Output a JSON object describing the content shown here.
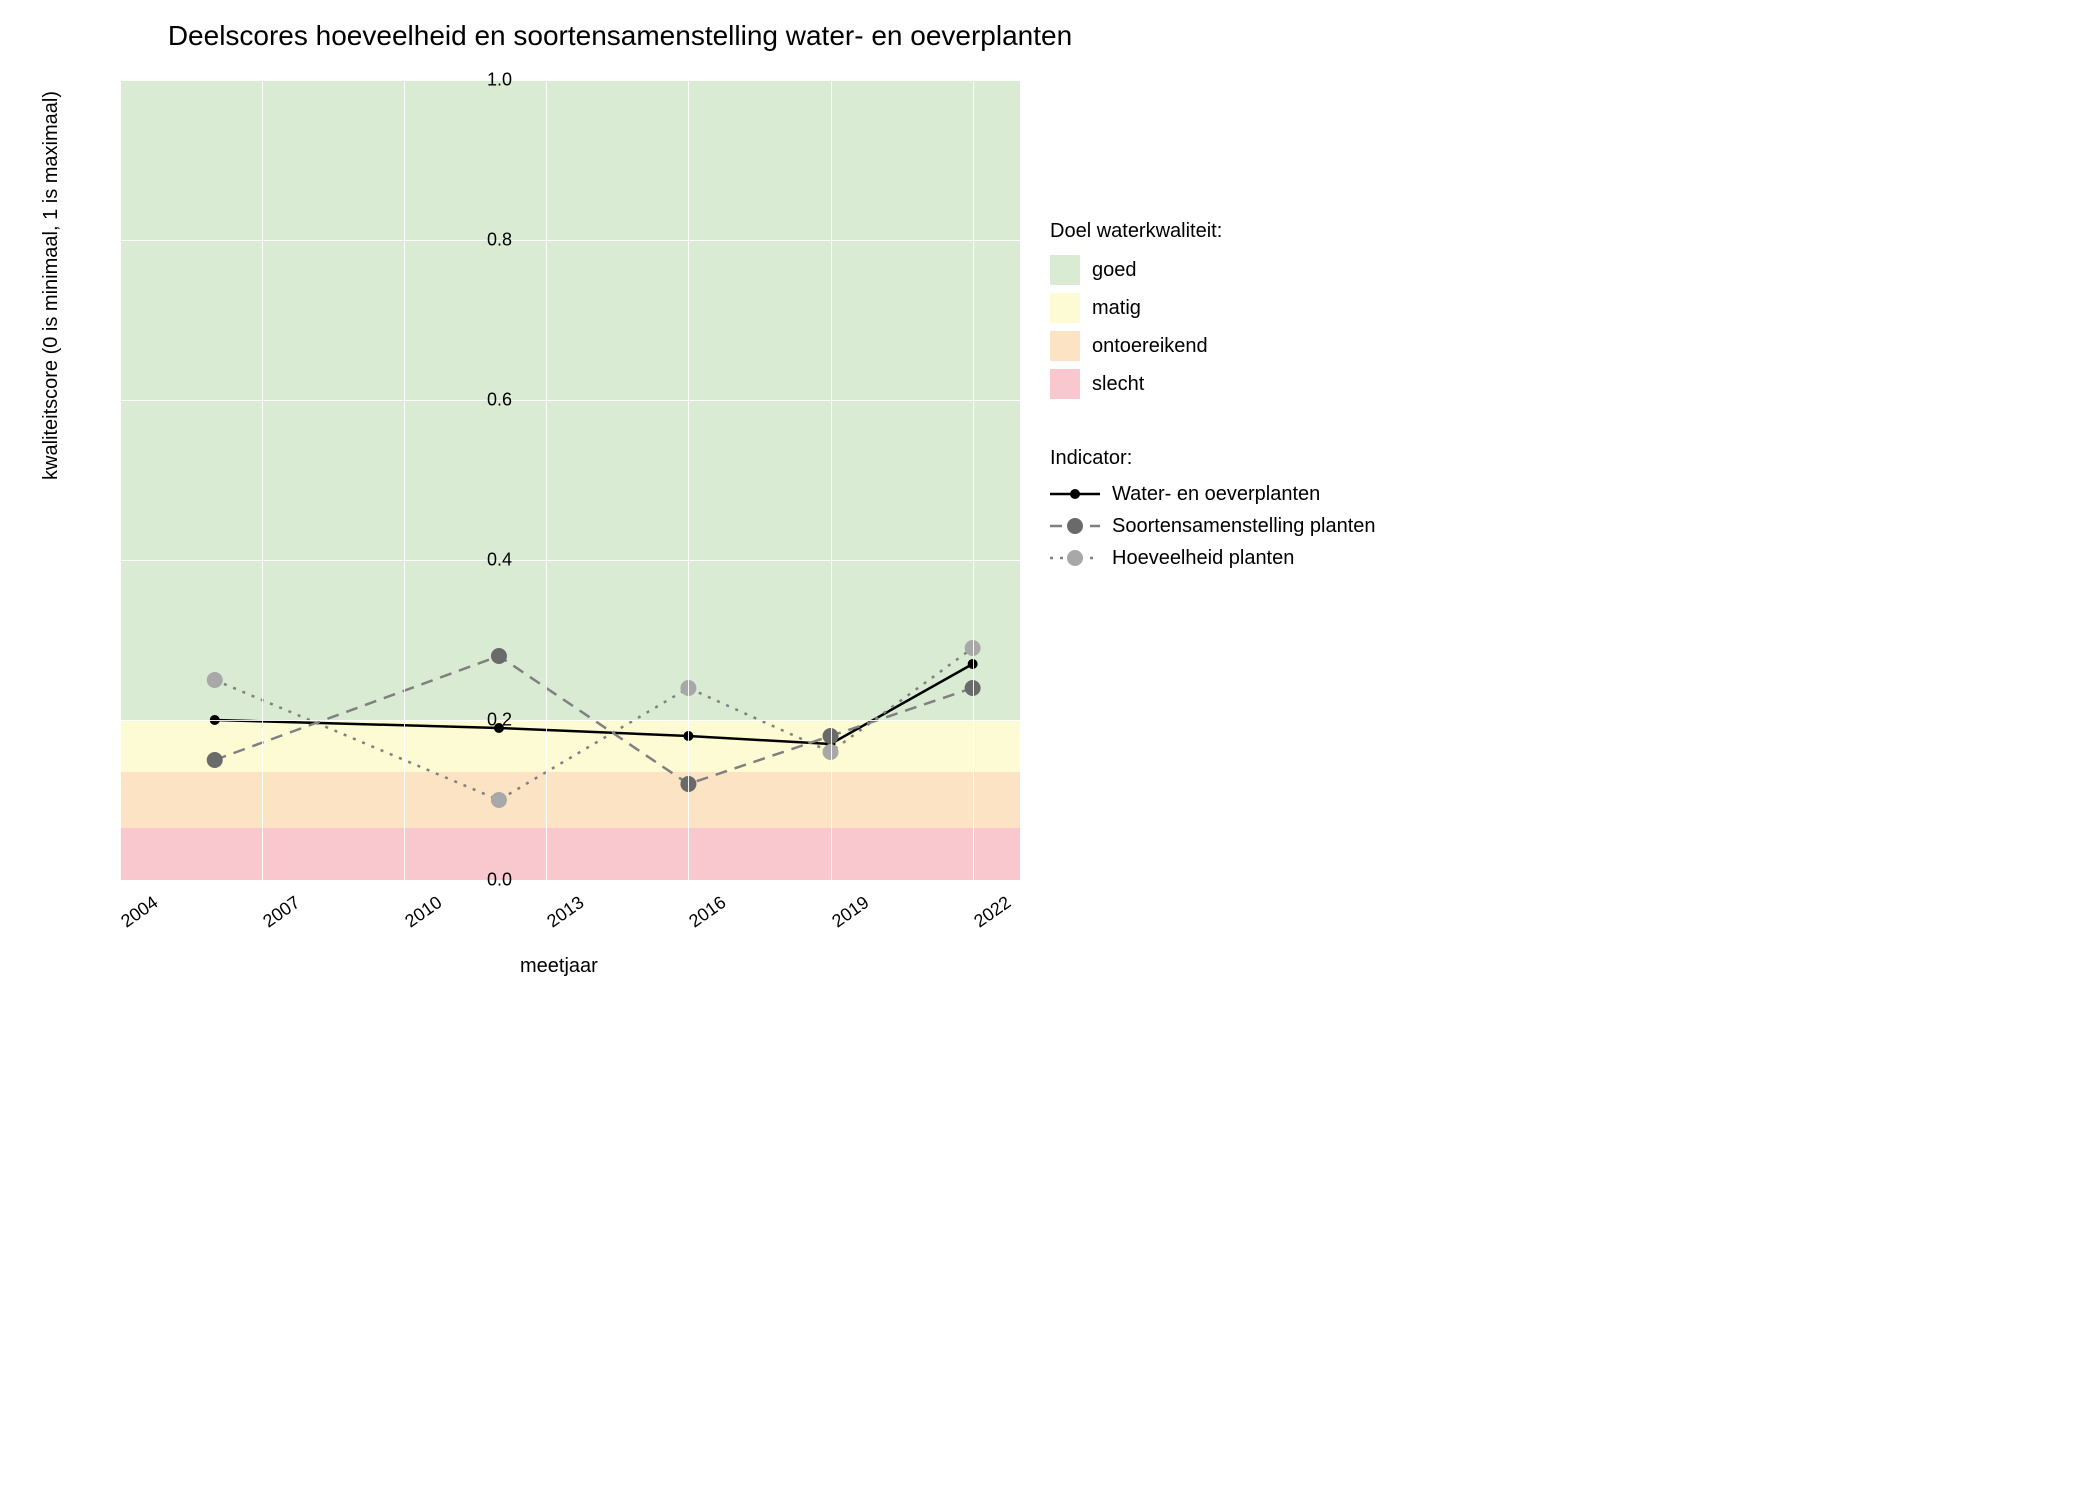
{
  "chart_data": {
    "type": "line",
    "title": "Deelscores hoeveelheid en soortensamenstelling water- en oeverplanten",
    "xlabel": "meetjaar",
    "ylabel": "kwaliteitscore (0 is minimaal, 1 is maximaal)",
    "ylim": [
      0.0,
      1.0
    ],
    "xlim": [
      2004,
      2023
    ],
    "x_ticks": [
      2004,
      2007,
      2010,
      2013,
      2016,
      2019,
      2022
    ],
    "y_ticks": [
      0.0,
      0.2,
      0.4,
      0.6,
      0.8,
      1.0
    ],
    "bands": [
      {
        "name": "goed",
        "from": 0.2,
        "to": 1.0,
        "color": "#d9ecd3"
      },
      {
        "name": "matig",
        "from": 0.135,
        "to": 0.2,
        "color": "#fcfbd4"
      },
      {
        "name": "ontoereikend",
        "from": 0.065,
        "to": 0.135,
        "color": "#fce3c4"
      },
      {
        "name": "slecht",
        "from": 0.0,
        "to": 0.065,
        "color": "#f9c7ce"
      }
    ],
    "x": [
      2006,
      2012,
      2016,
      2019,
      2022
    ],
    "series": [
      {
        "name": "Water- en oeverplanten",
        "values": [
          0.2,
          0.19,
          0.18,
          0.17,
          0.27
        ],
        "style": "solid",
        "color": "#000000",
        "dot": "#000000",
        "size": 5
      },
      {
        "name": "Soortensamenstelling planten",
        "values": [
          0.15,
          0.28,
          0.12,
          0.18,
          0.24
        ],
        "style": "dashed",
        "color": "#808080",
        "dot": "#6a6a6a",
        "size": 8
      },
      {
        "name": "Hoeveelheid planten",
        "values": [
          0.25,
          0.1,
          0.24,
          0.16,
          0.29
        ],
        "style": "dotted",
        "color": "#808080",
        "dot": "#a8a8a8",
        "size": 8
      }
    ],
    "legend_bands_title": "Doel waterkwaliteit:",
    "legend_series_title": "Indicator:"
  }
}
